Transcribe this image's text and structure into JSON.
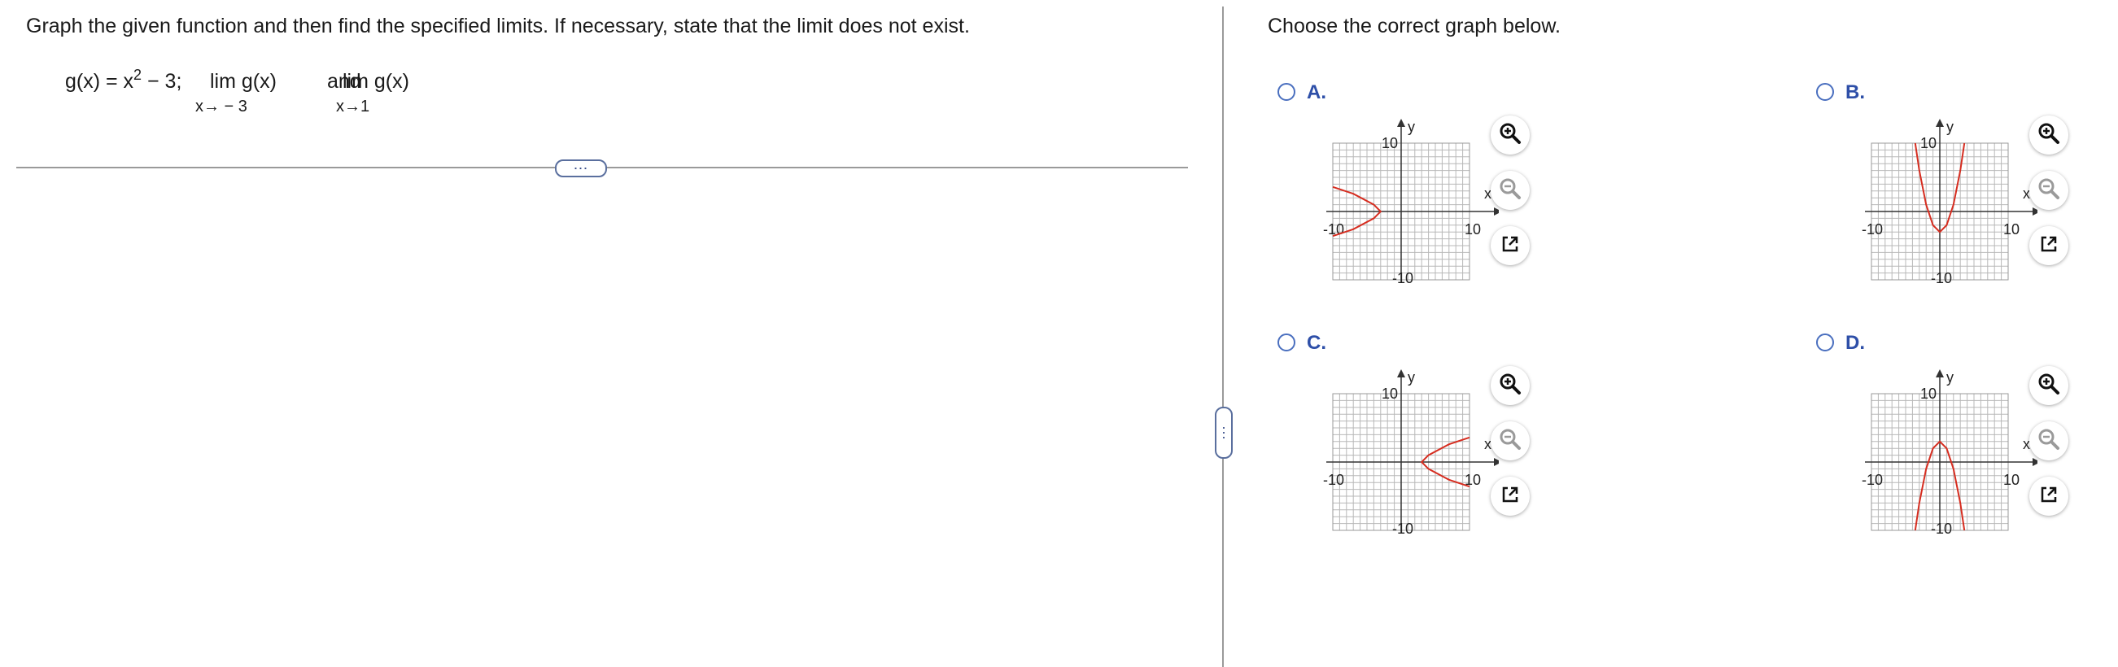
{
  "instruction": "Graph the given function and then find the specified limits. If necessary, state that the limit does not exist.",
  "problem": {
    "function_base": "g(x) = x",
    "exponent": "2",
    "function_tail": " − 3;",
    "limit1": "lim  g(x)",
    "limit1_sub": "x→ − 3",
    "connector": "and",
    "limit2": "lim g(x)",
    "limit2_sub": "x→1"
  },
  "expand_label": "⋯",
  "prompt": "Choose the correct graph below.",
  "graph_labels": {
    "y": "y",
    "x": "x",
    "pos": "10",
    "neg": "-10"
  },
  "colors": {
    "curve": "#d62d20",
    "accent": "#2e4fa8",
    "grid": "#b8b8b8"
  },
  "icons": {
    "zoom_in": "zoom-in-icon",
    "zoom_out": "zoom-out-icon",
    "popout": "popout-icon"
  },
  "options": [
    {
      "letter": "A.",
      "selected": false
    },
    {
      "letter": "B.",
      "selected": false
    },
    {
      "letter": "C.",
      "selected": false
    },
    {
      "letter": "D.",
      "selected": false
    }
  ],
  "chart_data": [
    {
      "type": "line",
      "option": "A",
      "xlim": [
        -10,
        10
      ],
      "ylim": [
        -10,
        10
      ],
      "grid": true,
      "series": [
        {
          "x": [
            -10,
            -7,
            -4,
            -3,
            -4,
            -7,
            -10
          ],
          "y": [
            3.6,
            2.6,
            1,
            0,
            -1,
            -2.6,
            -3.6
          ]
        }
      ]
    },
    {
      "type": "line",
      "option": "B",
      "xlim": [
        -10,
        10
      ],
      "ylim": [
        -10,
        10
      ],
      "grid": true,
      "series": [
        {
          "x": [
            -3.6,
            -3,
            -2,
            -1,
            0,
            1,
            2,
            3,
            3.6
          ],
          "y": [
            10,
            6,
            1,
            -2,
            -3,
            -2,
            1,
            6,
            10
          ]
        }
      ]
    },
    {
      "type": "line",
      "option": "C",
      "xlim": [
        -10,
        10
      ],
      "ylim": [
        -10,
        10
      ],
      "grid": true,
      "series": [
        {
          "x": [
            10,
            7,
            4,
            3,
            4,
            7,
            10
          ],
          "y": [
            3.6,
            2.6,
            1,
            0,
            -1,
            -2.6,
            -3.6
          ]
        }
      ]
    },
    {
      "type": "line",
      "option": "D",
      "xlim": [
        -10,
        10
      ],
      "ylim": [
        -10,
        10
      ],
      "grid": true,
      "series": [
        {
          "x": [
            -3.6,
            -3,
            -2,
            -1,
            0,
            1,
            2,
            3,
            3.6
          ],
          "y": [
            -10,
            -6,
            -1,
            2,
            3,
            2,
            -1,
            -6,
            -10
          ]
        }
      ]
    }
  ]
}
